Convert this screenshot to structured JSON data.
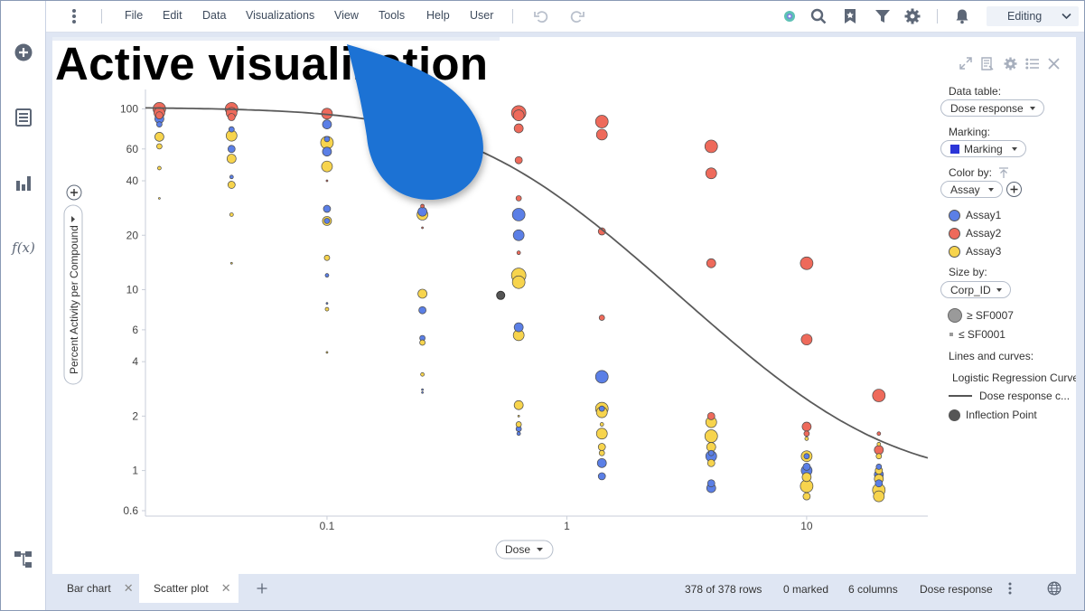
{
  "menu": {
    "items": [
      "File",
      "Edit",
      "Data",
      "Visualizations",
      "View",
      "Tools",
      "Help",
      "User"
    ],
    "mode": "Editing"
  },
  "viz": {
    "title": "Active visualization",
    "y_axis_label": "Percent Activity per Compound",
    "x_axis_label": "Dose"
  },
  "legend": {
    "data_table_label": "Data table:",
    "data_table_value": "Dose response",
    "marking_label": "Marking:",
    "marking_value": "Marking",
    "marking_color": "#2b35d8",
    "color_by_label": "Color by:",
    "color_by_value": "Assay",
    "color_items": [
      {
        "name": "Assay1",
        "color": "#5b7fe6"
      },
      {
        "name": "Assay2",
        "color": "#ee6a5b"
      },
      {
        "name": "Assay3",
        "color": "#f7d44d"
      }
    ],
    "size_by_label": "Size by:",
    "size_by_value": "Corp_ID",
    "size_max": "≥ SF0007",
    "size_min": "≤ SF0001",
    "lines_label": "Lines and curves:",
    "curve_group": "Logistic Regression Curve",
    "curve_item": "Dose response c...",
    "inflection_item": "Inflection Point"
  },
  "chart_data": {
    "type": "scatter",
    "xlabel": "Dose",
    "ylabel": "Percent Activity per Compound",
    "x_scale": "log",
    "y_scale": "log",
    "x_ticks": [
      "0.1",
      "1",
      "10"
    ],
    "y_ticks": [
      "0.6",
      "1",
      "2",
      "4",
      "6",
      "10",
      "20",
      "40",
      "60",
      "100"
    ],
    "xlim": [
      0.0175,
      32
    ],
    "ylim": [
      0.56,
      125
    ],
    "legend": "right",
    "series": [
      {
        "name": "Assay1",
        "color": "#5b7fe6",
        "points": [
          [
            0.02,
            88,
            5
          ],
          [
            0.02,
            82,
            3
          ],
          [
            0.04,
            60,
            4
          ],
          [
            0.04,
            42,
            2
          ],
          [
            0.04,
            77,
            3
          ],
          [
            0.1,
            82,
            5
          ],
          [
            0.1,
            58,
            5
          ],
          [
            0.1,
            28,
            4
          ],
          [
            0.1,
            24,
            3
          ],
          [
            0.1,
            12,
            2
          ],
          [
            0.1,
            8.4,
            1
          ],
          [
            0.1,
            68,
            3
          ],
          [
            0.25,
            27,
            5
          ],
          [
            0.25,
            7.7,
            4
          ],
          [
            0.25,
            5.4,
            3
          ],
          [
            0.25,
            2.8,
            1
          ],
          [
            0.25,
            2.7,
            1
          ],
          [
            0.63,
            26,
            7
          ],
          [
            0.63,
            20,
            6
          ],
          [
            0.63,
            6.2,
            5
          ],
          [
            0.63,
            1.7,
            3
          ],
          [
            0.63,
            1.6,
            2
          ],
          [
            1.4,
            3.3,
            7
          ],
          [
            1.4,
            1.1,
            5
          ],
          [
            1.4,
            0.93,
            4
          ],
          [
            1.4,
            2.2,
            3
          ],
          [
            4,
            0.8,
            5
          ],
          [
            4,
            0.85,
            4
          ],
          [
            4,
            1.2,
            6
          ],
          [
            4,
            1.25,
            3
          ],
          [
            10,
            1.0,
            6
          ],
          [
            10,
            1.05,
            4
          ],
          [
            10,
            1.2,
            3
          ],
          [
            20,
            0.95,
            5
          ],
          [
            20,
            0.85,
            4
          ],
          [
            20,
            1.05,
            3
          ]
        ]
      },
      {
        "name": "Assay2",
        "color": "#ee6a5b",
        "points": [
          [
            0.02,
            100,
            7
          ],
          [
            0.02,
            95,
            6
          ],
          [
            0.02,
            92,
            4
          ],
          [
            0.04,
            100,
            7
          ],
          [
            0.04,
            95,
            6
          ],
          [
            0.04,
            90,
            4
          ],
          [
            0.1,
            94,
            6
          ],
          [
            0.1,
            40,
            1
          ],
          [
            0.25,
            29,
            2
          ],
          [
            0.25,
            22,
            1
          ],
          [
            0.63,
            95,
            8
          ],
          [
            0.63,
            92,
            6
          ],
          [
            0.63,
            78,
            5
          ],
          [
            0.63,
            52,
            4
          ],
          [
            0.63,
            32,
            3
          ],
          [
            0.63,
            16,
            2
          ],
          [
            1.4,
            85,
            7
          ],
          [
            1.4,
            72,
            6
          ],
          [
            1.4,
            21,
            4
          ],
          [
            1.4,
            7,
            3
          ],
          [
            4,
            62,
            7
          ],
          [
            4,
            44,
            6
          ],
          [
            4,
            14,
            5
          ],
          [
            4,
            2.0,
            4
          ],
          [
            10,
            14,
            7
          ],
          [
            10,
            5.3,
            6
          ],
          [
            10,
            1.75,
            5
          ],
          [
            10,
            1.6,
            3
          ],
          [
            20,
            2.6,
            7
          ],
          [
            20,
            1.3,
            5
          ],
          [
            20,
            1.6,
            2
          ]
        ]
      },
      {
        "name": "Assay3",
        "color": "#f7d44d",
        "points": [
          [
            0.02,
            70,
            5
          ],
          [
            0.02,
            62,
            3
          ],
          [
            0.02,
            47,
            2
          ],
          [
            0.02,
            32,
            1
          ],
          [
            0.04,
            71,
            6
          ],
          [
            0.04,
            53,
            5
          ],
          [
            0.04,
            38,
            4
          ],
          [
            0.04,
            26,
            2
          ],
          [
            0.04,
            14,
            1
          ],
          [
            0.1,
            65,
            7
          ],
          [
            0.1,
            48,
            6
          ],
          [
            0.1,
            24,
            5
          ],
          [
            0.1,
            15,
            3
          ],
          [
            0.1,
            7.8,
            2
          ],
          [
            0.1,
            4.5,
            1
          ],
          [
            0.25,
            26,
            6
          ],
          [
            0.25,
            9.5,
            5
          ],
          [
            0.25,
            5.1,
            3
          ],
          [
            0.25,
            3.4,
            2
          ],
          [
            0.63,
            12,
            8
          ],
          [
            0.63,
            11,
            7
          ],
          [
            0.63,
            5.6,
            6
          ],
          [
            0.63,
            2.3,
            5
          ],
          [
            0.63,
            1.8,
            3
          ],
          [
            0.63,
            2.0,
            1
          ],
          [
            1.4,
            2.2,
            7
          ],
          [
            1.4,
            2.1,
            6
          ],
          [
            1.4,
            1.6,
            6
          ],
          [
            1.4,
            1.35,
            4
          ],
          [
            1.4,
            1.25,
            3
          ],
          [
            1.4,
            1.8,
            2
          ],
          [
            4,
            1.85,
            6
          ],
          [
            4,
            1.55,
            7
          ],
          [
            4,
            1.35,
            5
          ],
          [
            4,
            1.1,
            4
          ],
          [
            10,
            1.2,
            6
          ],
          [
            10,
            0.82,
            7
          ],
          [
            10,
            0.92,
            5
          ],
          [
            10,
            0.72,
            4
          ],
          [
            10,
            1.5,
            2
          ],
          [
            20,
            0.78,
            7
          ],
          [
            20,
            0.72,
            6
          ],
          [
            20,
            0.9,
            5
          ],
          [
            20,
            1.0,
            4
          ],
          [
            20,
            1.2,
            3
          ],
          [
            20,
            1.4,
            2
          ]
        ]
      }
    ],
    "curve": {
      "name": "Dose response curve",
      "color": "#5a5a5a",
      "top": 102,
      "bottom": 0.85,
      "ec50": 0.53,
      "hill": 1.4
    },
    "inflection_point": {
      "x": 0.53,
      "y": 9.3
    }
  },
  "tabs": [
    {
      "label": "Bar chart"
    },
    {
      "label": "Scatter plot"
    }
  ],
  "status": {
    "rows": "378 of 378 rows",
    "marked": "0 marked",
    "columns": "6 columns",
    "table": "Dose response"
  }
}
